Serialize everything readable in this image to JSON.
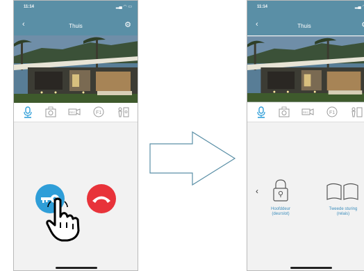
{
  "left_phone": {
    "status_time": "11:14",
    "title": "Thuis"
  },
  "right_phone": {
    "status_time": "11:14",
    "title": "Thuis",
    "controls": [
      {
        "label_line1": "Hoofddeur",
        "label_line2": "(deurslot)"
      },
      {
        "label_line1": "Tweede sturing",
        "label_line2": "(relais)"
      }
    ]
  },
  "colors": {
    "topbar": "#5a8fa6",
    "accent_blue": "#2f9ed8",
    "hangup_red": "#e8333a",
    "label_blue": "#3c8dbc"
  },
  "icons": [
    "microphone-icon",
    "camera-snapshot-icon",
    "record-icon",
    "f1-icon",
    "door-release-icon",
    "key-icon",
    "hang-up-icon",
    "hand-pointer-icon",
    "lock-icon",
    "gate-icon",
    "arrow-right-icon"
  ]
}
